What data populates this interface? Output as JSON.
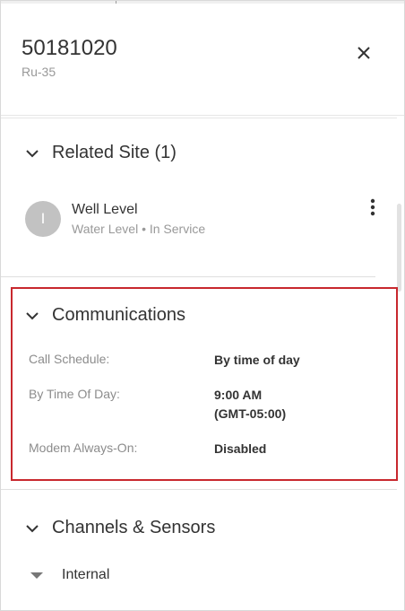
{
  "header": {
    "title": "50181020",
    "subtitle": "Ru-35"
  },
  "related_site": {
    "heading": "Related Site (1)",
    "site": {
      "avatar_letter": "I",
      "name": "Well Level",
      "meta": "Water Level • In Service"
    }
  },
  "communications": {
    "heading": "Communications",
    "rows": [
      {
        "label": "Call Schedule:",
        "value": "By time of day"
      },
      {
        "label": "By Time Of Day:",
        "value_line1": "9:00 AM",
        "value_line2": "(GMT-05:00)"
      },
      {
        "label": "Modem Always-On:",
        "value": "Disabled"
      }
    ]
  },
  "channels": {
    "heading": "Channels & Sensors",
    "groups": [
      {
        "label": "Internal"
      }
    ]
  },
  "colors": {
    "highlight_border": "#c8282e",
    "avatar_bg": "#c2c2c2"
  }
}
